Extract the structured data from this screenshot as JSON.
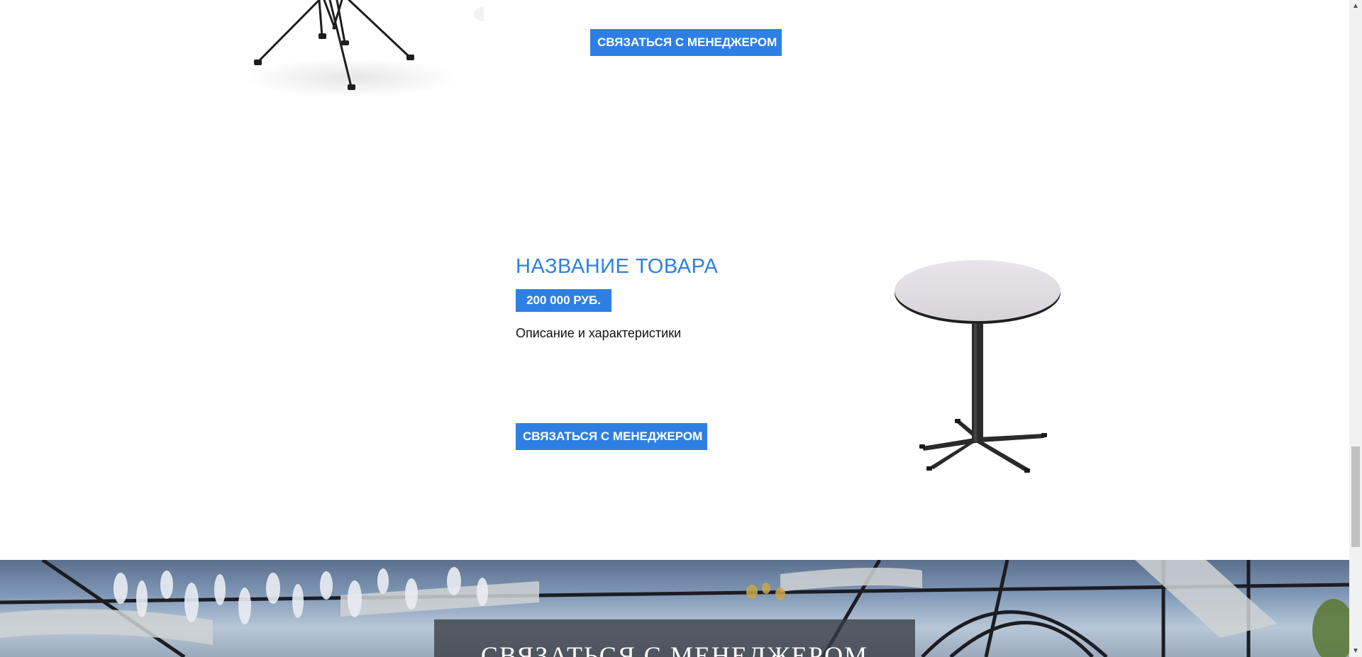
{
  "product_top": {
    "contact_button": "СВЯЗАТЬСЯ С МЕНЕДЖЕРОМ"
  },
  "product": {
    "title": "НАЗВАНИЕ ТОВАРА",
    "price": "200 000 РУБ.",
    "description": "Описание и характеристики",
    "contact_button": "СВЯЗАТЬСЯ С МЕНЕДЖЕРОМ"
  },
  "banner": {
    "title": "СВЯЗАТЬСЯ С МЕНЕДЖЕРОМ"
  },
  "colors": {
    "accent": "#2e7fe3",
    "text": "#111111",
    "background": "#ffffff"
  },
  "scrollbar": {
    "up_icon": "chevron-up-icon",
    "down_icon": "chevron-down-icon"
  }
}
